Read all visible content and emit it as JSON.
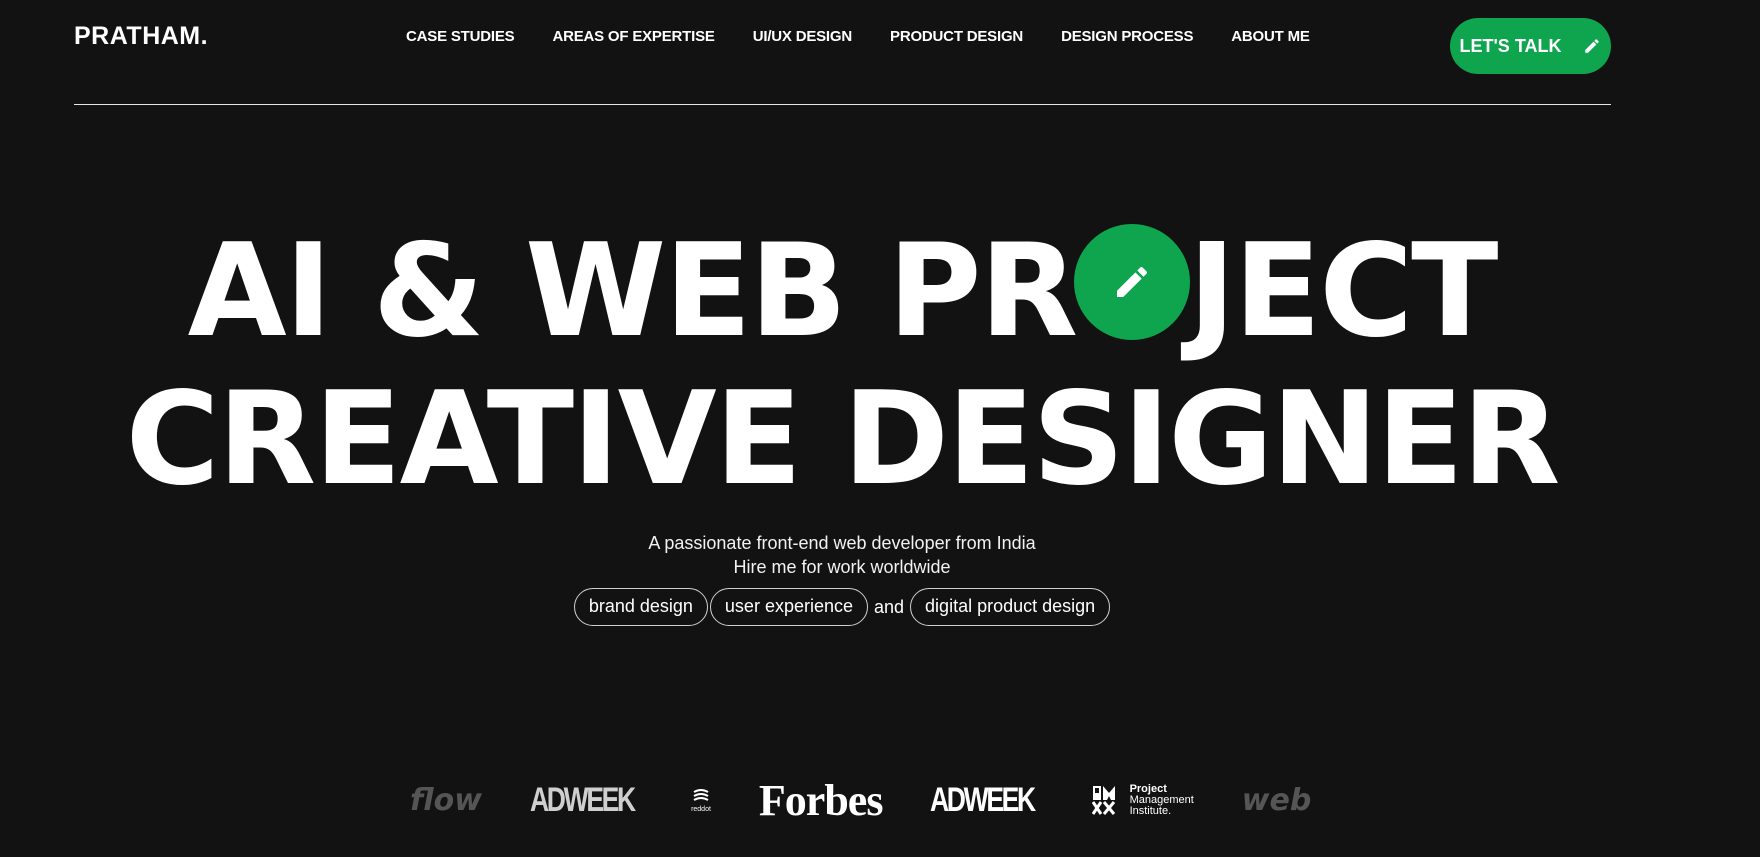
{
  "header": {
    "logo": "PRATHAM.",
    "nav": [
      "CASE STUDIES",
      "AREAS OF EXPERTISE",
      "UI/UX DESIGN",
      "PRODUCT DESIGN",
      "DESIGN PROCESS",
      "ABOUT ME"
    ],
    "cta_label": "LET'S TALK"
  },
  "hero": {
    "line1_before": "AI & WEB PR",
    "line1_after": "JECT",
    "line2": "CREATIVE DESIGNER",
    "accent_color": "#0fa54e"
  },
  "intro": {
    "line1": "A passionate front-end web developer from India",
    "line2": "Hire me for work worldwide",
    "tags": [
      "brand design",
      "user experience",
      "digital product design"
    ],
    "connector": "and"
  },
  "brands": {
    "flow": "flow",
    "adweek": "ADWEEK",
    "reddot": "reddot",
    "forbes": "Forbes",
    "pmi_line1": "Project",
    "pmi_line2": "Management",
    "pmi_line3": "Institute.",
    "web": "web"
  }
}
